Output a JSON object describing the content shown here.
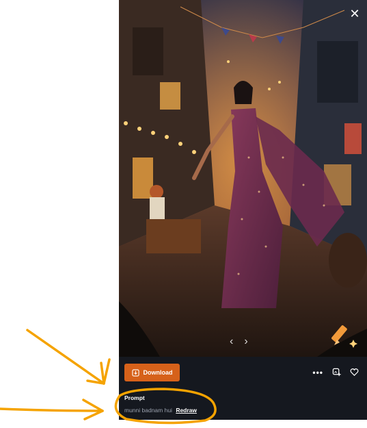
{
  "viewer": {
    "close_label": "✕",
    "prev_label": "‹",
    "next_label": "›",
    "edit_icon": "pencil-sparkle-icon"
  },
  "toolbar": {
    "download_label": "Download",
    "download_icon": "image-download-icon",
    "more_label": "•••",
    "more_icon": "more-dots-icon",
    "save_icon": "image-add-icon",
    "like_icon": "heart-icon"
  },
  "prompt": {
    "heading": "Prompt",
    "text": "munni badnam hui",
    "redraw_label": "Redraw"
  },
  "colors": {
    "accent": "#d6611a",
    "panel_bg": "#15181f",
    "annotation": "#f5a300"
  }
}
